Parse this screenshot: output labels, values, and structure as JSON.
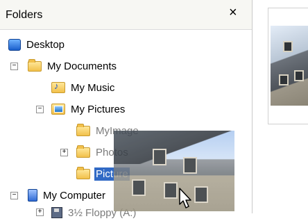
{
  "header": {
    "title": "Folders",
    "close_glyph": "×"
  },
  "tree": {
    "items": [
      {
        "label": "Desktop",
        "icon": "desktop-icon"
      },
      {
        "label": "My Documents",
        "icon": "my-documents-folder-icon"
      },
      {
        "label": "My Music",
        "icon": "music-folder-icon"
      },
      {
        "label": "My Pictures",
        "icon": "pictures-folder-icon"
      },
      {
        "label": "MyImage",
        "icon": "folder-icon",
        "state": "dimmed"
      },
      {
        "label": "Photos",
        "icon": "folder-icon",
        "state": "dimmed"
      },
      {
        "label": "Picture",
        "icon": "folder-icon",
        "state": "selected"
      },
      {
        "label": "My Computer",
        "icon": "computer-icon"
      },
      {
        "label": "3½ Floppy (A:)",
        "icon": "floppy-icon",
        "state": "dimmed"
      }
    ]
  },
  "colors": {
    "selection": "#316ac5",
    "header_bg": "#f7f7f3"
  }
}
